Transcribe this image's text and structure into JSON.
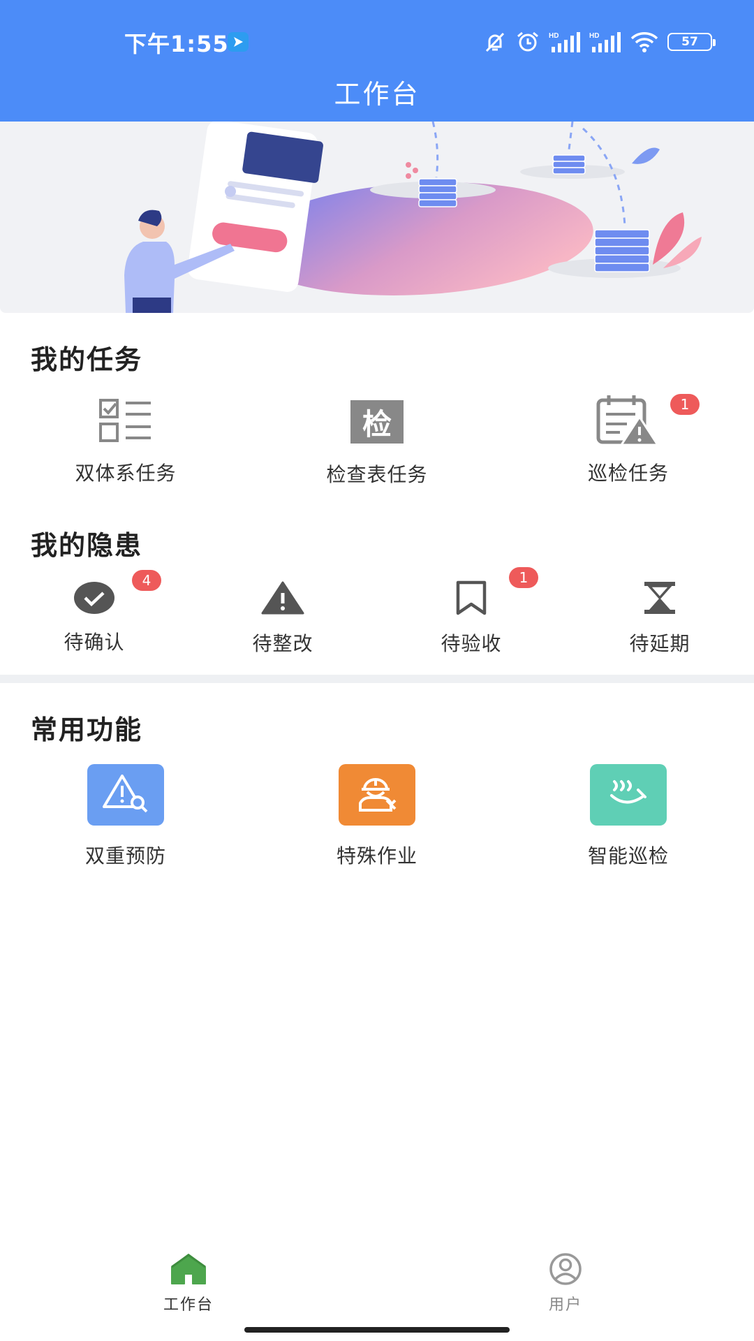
{
  "status_bar": {
    "time": "下午1:55",
    "battery": "57"
  },
  "header": {
    "title": "工作台"
  },
  "tasks": {
    "title": "我的任务",
    "items": [
      {
        "label": "双体系任务",
        "badge": ""
      },
      {
        "label": "检查表任务",
        "badge": "",
        "icon_text": "检"
      },
      {
        "label": "巡检任务",
        "badge": "1"
      }
    ]
  },
  "hazards": {
    "title": "我的隐患",
    "items": [
      {
        "label": "待确认",
        "badge": "4"
      },
      {
        "label": "待整改",
        "badge": ""
      },
      {
        "label": "待验收",
        "badge": "1"
      },
      {
        "label": "待延期",
        "badge": ""
      }
    ]
  },
  "functions": {
    "title": "常用功能",
    "items": [
      {
        "label": "双重预防",
        "color": "#6a9ef2"
      },
      {
        "label": "特殊作业",
        "color": "#f08a35"
      },
      {
        "label": "智能巡检",
        "color": "#5fcfb5"
      }
    ]
  },
  "nav": {
    "items": [
      {
        "label": "工作台",
        "active": true,
        "color": "#4da64d"
      },
      {
        "label": "用户",
        "active": false,
        "color": "#999999"
      }
    ]
  },
  "colors": {
    "primary": "#4c8cf8",
    "badge": "#ee5a5a",
    "nav_active": "#4da64d"
  }
}
